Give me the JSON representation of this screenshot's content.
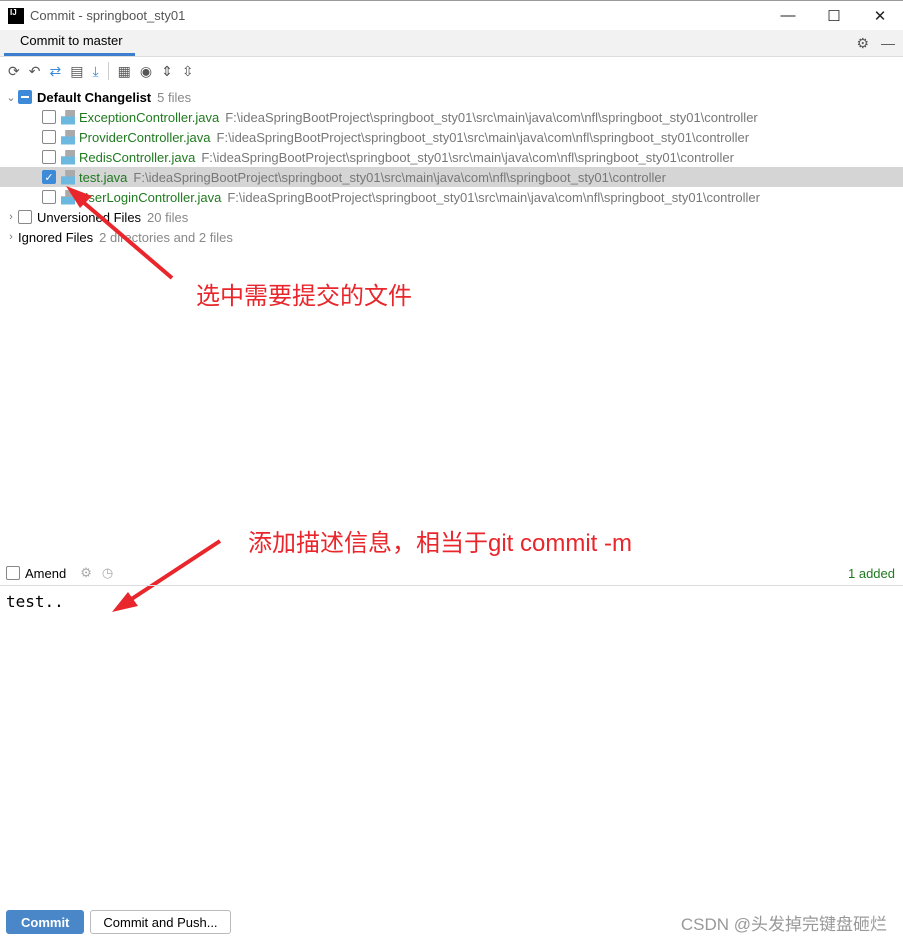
{
  "window": {
    "logo": "IJ",
    "title": "Commit - springboot_sty01",
    "controls": [
      "—",
      "☐",
      "✕"
    ]
  },
  "tab": {
    "label": "Commit to master"
  },
  "toolbar_icons": [
    "refresh-icon",
    "rollback-icon",
    "diff-icon",
    "history-icon",
    "update-icon",
    "group-by-icon",
    "view-options-icon",
    "expand-all-icon",
    "collapse-all-icon"
  ],
  "changelist": {
    "name": "Default Changelist",
    "count": "5 files",
    "files": [
      {
        "name": "ExceptionController.java",
        "path": "F:\\ideaSpringBootProject\\springboot_sty01\\src\\main\\java\\com\\nfl\\springboot_sty01\\controller",
        "checked": false
      },
      {
        "name": "ProviderController.java",
        "path": "F:\\ideaSpringBootProject\\springboot_sty01\\src\\main\\java\\com\\nfl\\springboot_sty01\\controller",
        "checked": false
      },
      {
        "name": "RedisController.java",
        "path": "F:\\ideaSpringBootProject\\springboot_sty01\\src\\main\\java\\com\\nfl\\springboot_sty01\\controller",
        "checked": false
      },
      {
        "name": "test.java",
        "path": "F:\\ideaSpringBootProject\\springboot_sty01\\src\\main\\java\\com\\nfl\\springboot_sty01\\controller",
        "checked": true
      },
      {
        "name": "UserLoginController.java",
        "path": "F:\\ideaSpringBootProject\\springboot_sty01\\src\\main\\java\\com\\nfl\\springboot_sty01\\controller",
        "checked": false
      }
    ]
  },
  "unversioned": {
    "label": "Unversioned Files",
    "count": "20 files"
  },
  "ignored": {
    "label": "Ignored Files",
    "count": "2 directories and 2 files"
  },
  "amend": {
    "label": "Amend",
    "status": "1 added"
  },
  "commit_message": "test..",
  "buttons": {
    "commit": "Commit",
    "commit_push": "Commit and Push..."
  },
  "annotations": {
    "select": "选中需要提交的文件",
    "describe": "添加描述信息，相当于git commit -m",
    "color": "#e8262b"
  },
  "watermark": "CSDN @头发掉完键盘砸烂"
}
